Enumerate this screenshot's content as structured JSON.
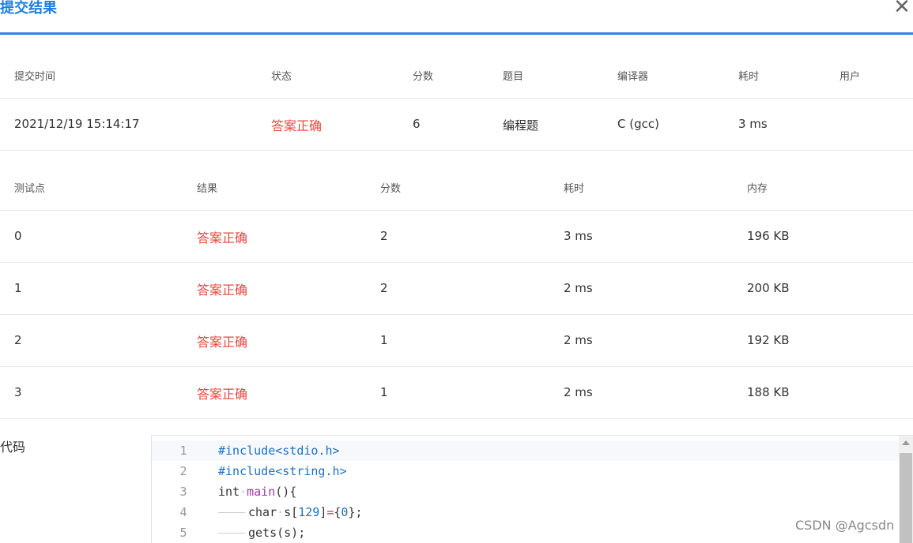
{
  "dialog": {
    "title": "提交结果",
    "close_icon": "close-icon"
  },
  "submission": {
    "headers": [
      "提交时间",
      "状态",
      "分数",
      "题目",
      "编译器",
      "耗时",
      "用户"
    ],
    "row": [
      "2021/12/19 15:14:17",
      "答案正确",
      "6",
      "编程题",
      "C (gcc)",
      "3 ms",
      ""
    ]
  },
  "testpoints": {
    "headers": [
      "测试点",
      "结果",
      "分数",
      "耗时",
      "内存"
    ],
    "rows": [
      [
        "0",
        "答案正确",
        "2",
        "3 ms",
        "196 KB"
      ],
      [
        "1",
        "答案正确",
        "2",
        "2 ms",
        "200 KB"
      ],
      [
        "2",
        "答案正确",
        "1",
        "2 ms",
        "192 KB"
      ],
      [
        "3",
        "答案正确",
        "1",
        "2 ms",
        "188 KB"
      ]
    ]
  },
  "code": {
    "label": "代码",
    "line_numbers": [
      "1",
      "2",
      "3",
      "4",
      "5"
    ]
  },
  "colors": {
    "accent": "#2b85e4",
    "status_ok": "#e8473c"
  },
  "watermark": "CSDN @Agcsdn"
}
